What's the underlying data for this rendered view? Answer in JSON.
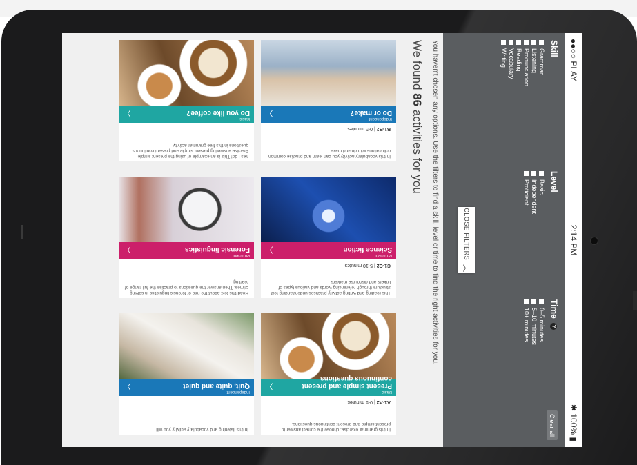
{
  "status_bar": {
    "carrier": "●●○○ PLAY",
    "time": "2:14 PM",
    "battery": "100%"
  },
  "filters": {
    "skill": {
      "title": "Skill",
      "options": [
        "Grammar",
        "Listening",
        "Pronunciation",
        "Reading",
        "Vocabulary",
        "Writing"
      ]
    },
    "level": {
      "title": "Level",
      "options": [
        "Basic",
        "Independent",
        "Proficient"
      ]
    },
    "time": {
      "title": "Time",
      "help": "?",
      "options": [
        "0–5 minutes",
        "5–10 minutes",
        "10+ minutes"
      ]
    },
    "clear_all": "Clear all",
    "close_label": "CLOSE FILTERS"
  },
  "message": "You haven't chosen any options. Use the filters to find a skill, level or time to find the right activities for you.",
  "found": {
    "prefix": "We found",
    "count": "86",
    "suffix": "activities for you"
  },
  "cards": [
    {
      "level": "Independent",
      "title": "Do or make?",
      "text": "In this vocabulary activity you can learn and practise common collocations with do and make.",
      "cefr": "B1-B2",
      "time": "0-5 minutes"
    },
    {
      "level": "Basic",
      "title": "Do you like coffee?",
      "text": "Yes I do! This is an example of using the present simple. Practise answering present simple and present continuous questions in this free grammar activity.",
      "cefr": "",
      "time": ""
    },
    {
      "level": "Proficient",
      "title": "Science fiction",
      "text": "This reading and writing activity practises understanding text structure through referencing words and various types of linkers and discourse markers.",
      "cefr": "C1-C2",
      "time": "5-10 minutes"
    },
    {
      "level": "Proficient",
      "title": "Forensic linguistics",
      "text": "Read this text about the role of forensic linguistics in solving crimes. Then answer the questions to practise the full range of reading",
      "cefr": "",
      "time": ""
    },
    {
      "level": "Basic",
      "title": "Present simple and present continuous questions",
      "text": "In this grammar exercise, choose the correct answer to present simple and present continuous questions.",
      "cefr": "A1-A2",
      "time": "0-5 minutes"
    },
    {
      "level": "Independent",
      "title": "Quit, quite and quiet",
      "text": "In this listening and vocabulary activity you will",
      "cefr": "",
      "time": ""
    }
  ]
}
